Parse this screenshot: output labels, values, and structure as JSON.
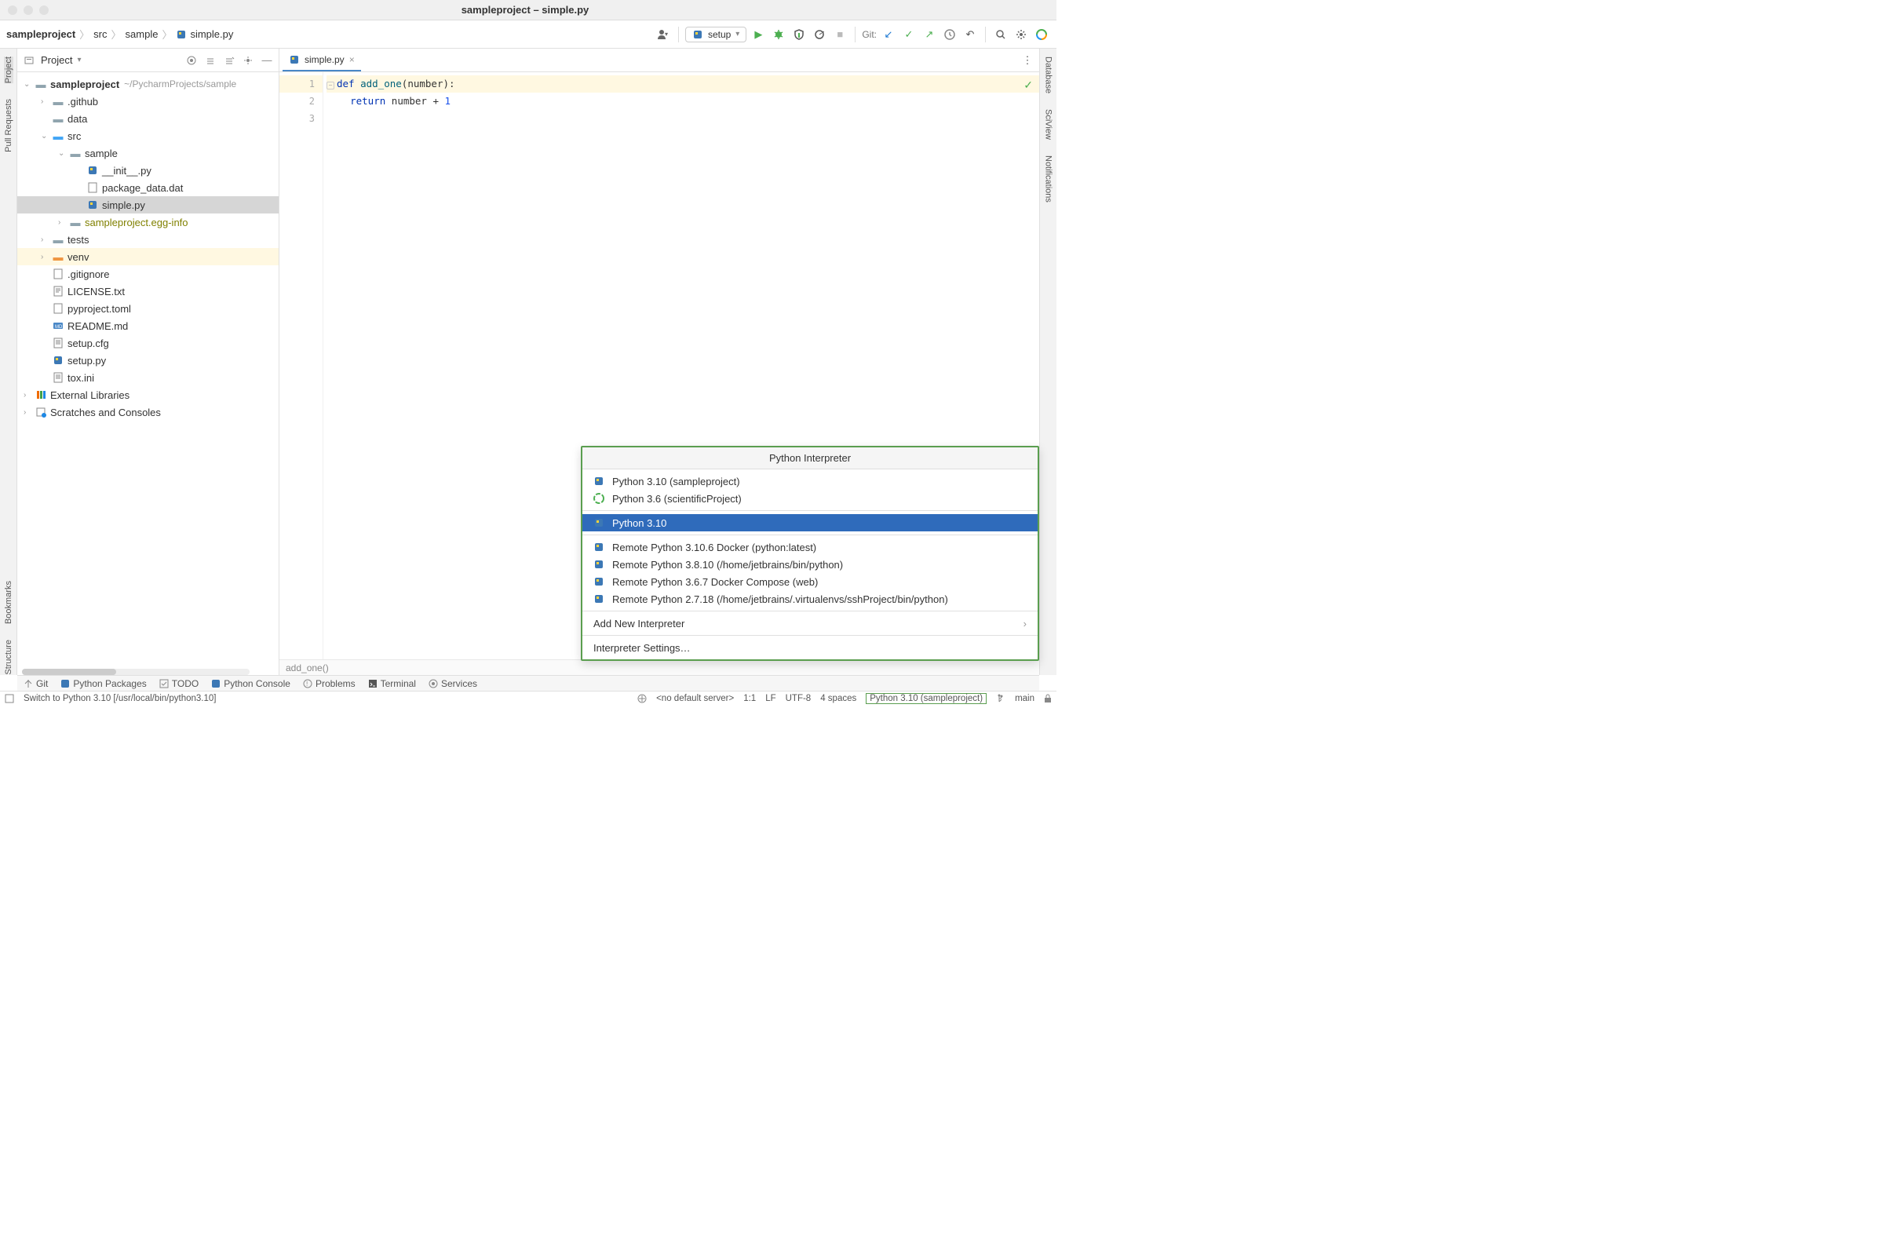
{
  "window": {
    "title": "sampleproject – simple.py"
  },
  "breadcrumb": {
    "items": [
      "sampleproject",
      "src",
      "sample",
      "simple.py"
    ]
  },
  "toolbar": {
    "run_config_label": "setup",
    "git_label": "Git:"
  },
  "project_panel": {
    "title": "Project",
    "root": {
      "name": "sampleproject",
      "path": "~/PycharmProjects/sample"
    },
    "tree": {
      "n_github": ".github",
      "n_data": "data",
      "n_src": "src",
      "n_sample": "sample",
      "n_init": "__init__.py",
      "n_pkgdata": "package_data.dat",
      "n_simple": "simple.py",
      "n_egginfo": "sampleproject.egg-info",
      "n_tests": "tests",
      "n_venv": "venv",
      "n_gitignore": ".gitignore",
      "n_license": "LICENSE.txt",
      "n_pyproject": "pyproject.toml",
      "n_readme": "README.md",
      "n_setupcfg": "setup.cfg",
      "n_setuppy": "setup.py",
      "n_toxini": "tox.ini",
      "n_extlib": "External Libraries",
      "n_scratches": "Scratches and Consoles"
    }
  },
  "left_tools": {
    "project": "Project",
    "pull_requests": "Pull Requests",
    "bookmarks": "Bookmarks",
    "structure": "Structure"
  },
  "right_tools": {
    "database": "Database",
    "sciview": "SciView",
    "notifications": "Notifications"
  },
  "editor": {
    "tab_label": "simple.py",
    "line1_kw_def": "def",
    "line1_fn": "add_one",
    "line1_rest": "(number):",
    "line2_kw": "return",
    "line2_mid": " number + ",
    "line2_num": "1",
    "ln1": "1",
    "ln2": "2",
    "ln3": "3",
    "crumb": "add_one()"
  },
  "interpreter_popup": {
    "title": "Python Interpreter",
    "items": [
      {
        "label": "Python 3.10 (sampleproject)",
        "icon": "python"
      },
      {
        "label": "Python 3.6 (scientificProject)",
        "icon": "conda"
      },
      {
        "label": "Python 3.10",
        "icon": "python",
        "selected": true
      },
      {
        "label": "Remote Python 3.10.6 Docker (python:latest)",
        "icon": "python"
      },
      {
        "label": "Remote Python 3.8.10 (/home/jetbrains/bin/python)",
        "icon": "python"
      },
      {
        "label": "Remote Python 3.6.7 Docker Compose (web)",
        "icon": "python"
      },
      {
        "label": "Remote Python 2.7.18 (/home/jetbrains/.virtualenvs/sshProject/bin/python)",
        "icon": "python"
      }
    ],
    "add_new": "Add New Interpreter",
    "settings": "Interpreter Settings…"
  },
  "bottom_tools": {
    "git": "Git",
    "packages": "Python Packages",
    "todo": "TODO",
    "console": "Python Console",
    "problems": "Problems",
    "terminal": "Terminal",
    "services": "Services"
  },
  "status_bar": {
    "hint": "Switch to Python 3.10 [/usr/local/bin/python3.10]",
    "server": "<no default server>",
    "pos": "1:1",
    "lineend": "LF",
    "encoding": "UTF-8",
    "indent": "4 spaces",
    "interpreter": "Python 3.10 (sampleproject)",
    "branch": "main"
  }
}
